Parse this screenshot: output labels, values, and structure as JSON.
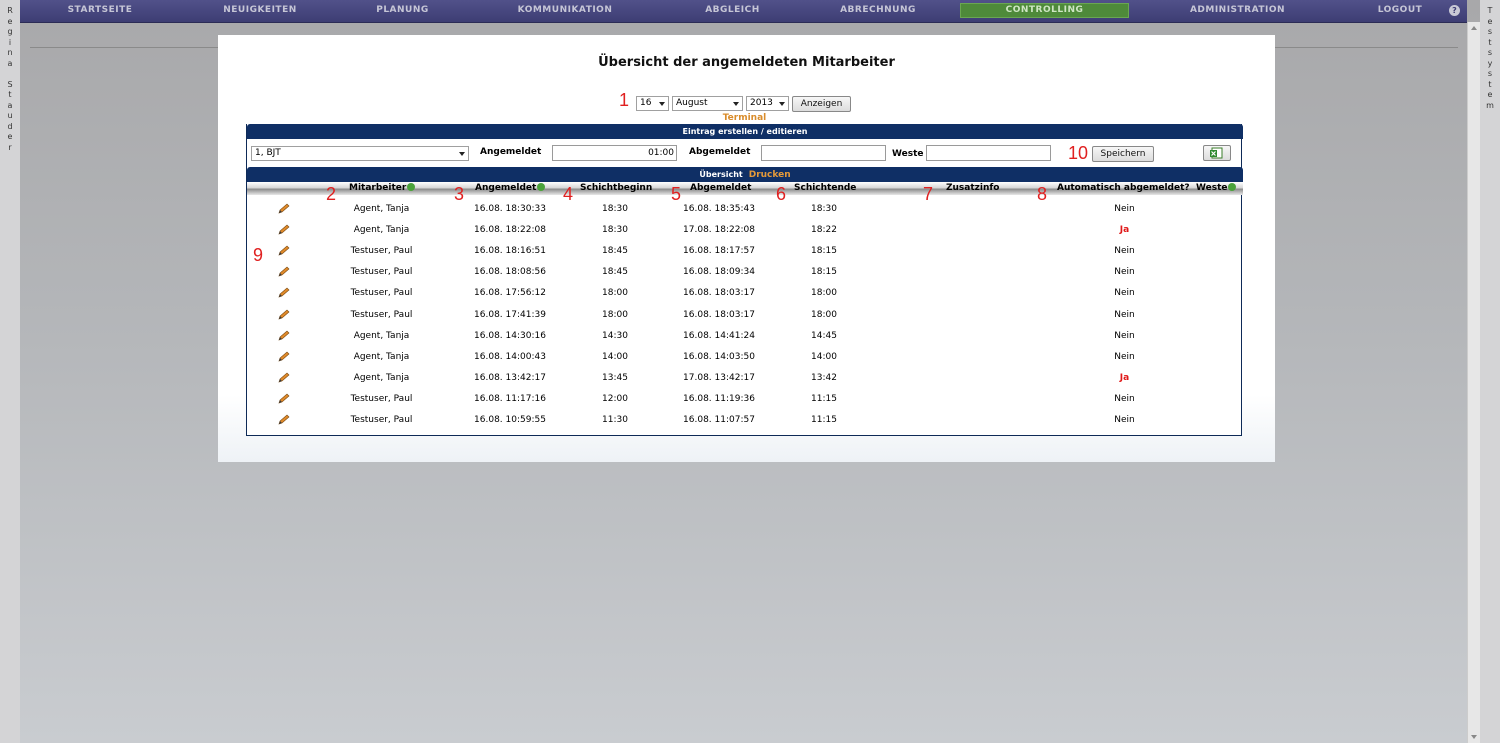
{
  "sidebar_left": {
    "letters": [
      "R",
      "e",
      "g",
      "i",
      "n",
      "a",
      " ",
      "S",
      "t",
      "a",
      "u",
      "d",
      "e",
      "r"
    ]
  },
  "sidebar_right": {
    "letters": [
      "T",
      "e",
      "s",
      "t",
      "s",
      "y",
      "s",
      "t",
      "e",
      "m"
    ]
  },
  "nav": {
    "items": [
      "STARTSEITE",
      "NEUIGKEITEN",
      "PLANUNG",
      "KOMMUNIKATION",
      "ABGLEICH",
      "ABRECHNUNG",
      "CONTROLLING",
      "ADMINISTRATION",
      "LOGOUT"
    ],
    "active": "CONTROLLING",
    "help_glyph": "?"
  },
  "page": {
    "title": "Übersicht der angemeldeten Mitarbeiter",
    "filter": {
      "day": "16",
      "month": "August",
      "year": "2013",
      "button": "Anzeigen"
    },
    "terminal_link": "Terminal"
  },
  "markers": [
    "1",
    "2",
    "3",
    "4",
    "5",
    "6",
    "7",
    "8",
    "9",
    "10"
  ],
  "form": {
    "header": "Eintrag erstellen / editieren",
    "location_value": "1, BJT",
    "label_angemeldet": "Angemeldet",
    "angemeldet_value": "01:00",
    "label_abgemeldet": "Abgemeldet",
    "abgemeldet_value": "",
    "label_weste": "Weste",
    "weste_value": "",
    "save_button": "Speichern"
  },
  "overview": {
    "header": "Übersicht",
    "print_link": "Drucken",
    "columns": [
      "Mitarbeiter",
      "Angemeldet",
      "Schichtbeginn",
      "Abgemeldet",
      "Schichtende",
      "Zusatzinfo",
      "Automatisch abgemeldet?",
      "Weste"
    ],
    "rows": [
      {
        "name": "Agent, Tanja",
        "angemeldet": "16.08. 18:30:33",
        "schichtbeginn": "18:30",
        "abgemeldet": "16.08. 18:35:43",
        "schichtende": "18:30",
        "zusatz": "",
        "auto": "Nein",
        "weste": ""
      },
      {
        "name": "Agent, Tanja",
        "angemeldet": "16.08. 18:22:08",
        "schichtbeginn": "18:30",
        "abgemeldet": "17.08. 18:22:08",
        "schichtende": "18:22",
        "zusatz": "",
        "auto": "Ja",
        "weste": ""
      },
      {
        "name": "Testuser, Paul",
        "angemeldet": "16.08. 18:16:51",
        "schichtbeginn": "18:45",
        "abgemeldet": "16.08. 18:17:57",
        "schichtende": "18:15",
        "zusatz": "",
        "auto": "Nein",
        "weste": ""
      },
      {
        "name": "Testuser, Paul",
        "angemeldet": "16.08. 18:08:56",
        "schichtbeginn": "18:45",
        "abgemeldet": "16.08. 18:09:34",
        "schichtende": "18:15",
        "zusatz": "",
        "auto": "Nein",
        "weste": ""
      },
      {
        "name": "Testuser, Paul",
        "angemeldet": "16.08. 17:56:12",
        "schichtbeginn": "18:00",
        "abgemeldet": "16.08. 18:03:17",
        "schichtende": "18:00",
        "zusatz": "",
        "auto": "Nein",
        "weste": ""
      },
      {
        "name": "Testuser, Paul",
        "angemeldet": "16.08. 17:41:39",
        "schichtbeginn": "18:00",
        "abgemeldet": "16.08. 18:03:17",
        "schichtende": "18:00",
        "zusatz": "",
        "auto": "Nein",
        "weste": ""
      },
      {
        "name": "Agent, Tanja",
        "angemeldet": "16.08. 14:30:16",
        "schichtbeginn": "14:30",
        "abgemeldet": "16.08. 14:41:24",
        "schichtende": "14:45",
        "zusatz": "",
        "auto": "Nein",
        "weste": ""
      },
      {
        "name": "Agent, Tanja",
        "angemeldet": "16.08. 14:00:43",
        "schichtbeginn": "14:00",
        "abgemeldet": "16.08. 14:03:50",
        "schichtende": "14:00",
        "zusatz": "",
        "auto": "Nein",
        "weste": ""
      },
      {
        "name": "Agent, Tanja",
        "angemeldet": "16.08. 13:42:17",
        "schichtbeginn": "13:45",
        "abgemeldet": "17.08. 13:42:17",
        "schichtende": "13:42",
        "zusatz": "",
        "auto": "Ja",
        "weste": ""
      },
      {
        "name": "Testuser, Paul",
        "angemeldet": "16.08. 11:17:16",
        "schichtbeginn": "12:00",
        "abgemeldet": "16.08. 11:19:36",
        "schichtende": "11:15",
        "zusatz": "",
        "auto": "Nein",
        "weste": ""
      },
      {
        "name": "Testuser, Paul",
        "angemeldet": "16.08. 10:59:55",
        "schichtbeginn": "11:30",
        "abgemeldet": "16.08. 11:07:57",
        "schichtende": "11:15",
        "zusatz": "",
        "auto": "Nein",
        "weste": ""
      }
    ]
  }
}
